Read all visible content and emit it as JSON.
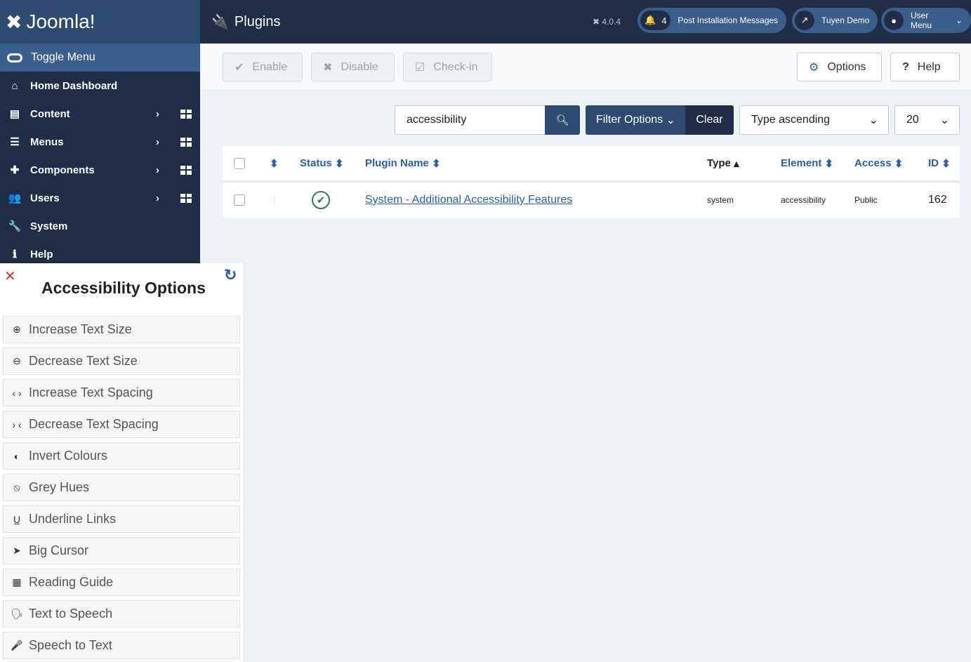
{
  "brand": "Joomla!",
  "sidebar": {
    "toggle": "Toggle Menu",
    "items": [
      {
        "label": "Home Dashboard",
        "icon": "home-icon",
        "glyph": "⌂",
        "sub": false
      },
      {
        "label": "Content",
        "icon": "file-icon",
        "glyph": "▤",
        "sub": true
      },
      {
        "label": "Menus",
        "icon": "list-icon",
        "glyph": "☰",
        "sub": true
      },
      {
        "label": "Components",
        "icon": "puzzle-icon",
        "glyph": "✚",
        "sub": true
      },
      {
        "label": "Users",
        "icon": "users-icon",
        "glyph": "👥",
        "sub": true
      },
      {
        "label": "System",
        "icon": "wrench-icon",
        "glyph": "🔧",
        "sub": false
      },
      {
        "label": "Help",
        "icon": "info-icon",
        "glyph": "ℹ",
        "sub": false
      }
    ]
  },
  "header": {
    "title": "Plugins",
    "version": "4.0.4",
    "notifications_count": "4",
    "post_install": "Post Installation Messages",
    "site": "Tuyen Demo",
    "user_menu": "User Menu"
  },
  "toolbar": {
    "enable": "Enable",
    "disable": "Disable",
    "checkin": "Check-in",
    "options": "Options",
    "help": "Help"
  },
  "filters": {
    "search_value": "accessibility",
    "filter_options": "Filter Options",
    "clear": "Clear",
    "ordering": "Type ascending",
    "limit": "20"
  },
  "table": {
    "columns": {
      "status": "Status",
      "name": "Plugin Name",
      "type": "Type",
      "element": "Element",
      "access": "Access",
      "id": "ID"
    },
    "rows": [
      {
        "status": "enabled",
        "name": "System - Additional Accessibility Features",
        "type": "system",
        "element": "accessibility",
        "access": "Public",
        "id": "162"
      }
    ]
  },
  "accessibility": {
    "title": "Accessibility Options",
    "items": [
      {
        "label": "Increase Text Size",
        "glyph": "⊕"
      },
      {
        "label": "Decrease Text Size",
        "glyph": "⊖"
      },
      {
        "label": "Increase Text Spacing",
        "glyph": "‹ ›"
      },
      {
        "label": "Decrease Text Spacing",
        "glyph": "› ‹"
      },
      {
        "label": "Invert Colours",
        "glyph": "◐"
      },
      {
        "label": "Grey Hues",
        "glyph": "⦸"
      },
      {
        "label": "Underline Links",
        "glyph": "U̲"
      },
      {
        "label": "Big Cursor",
        "glyph": "➤"
      },
      {
        "label": "Reading Guide",
        "glyph": "▦"
      },
      {
        "label": "Text to Speech",
        "glyph": "🗣"
      },
      {
        "label": "Speech to Text",
        "glyph": "🎤"
      }
    ]
  },
  "colors": {
    "sidebar": "#1f2e46",
    "accent": "#2d4a70",
    "link": "#2a5eaa",
    "success": "#2f7d4a"
  }
}
